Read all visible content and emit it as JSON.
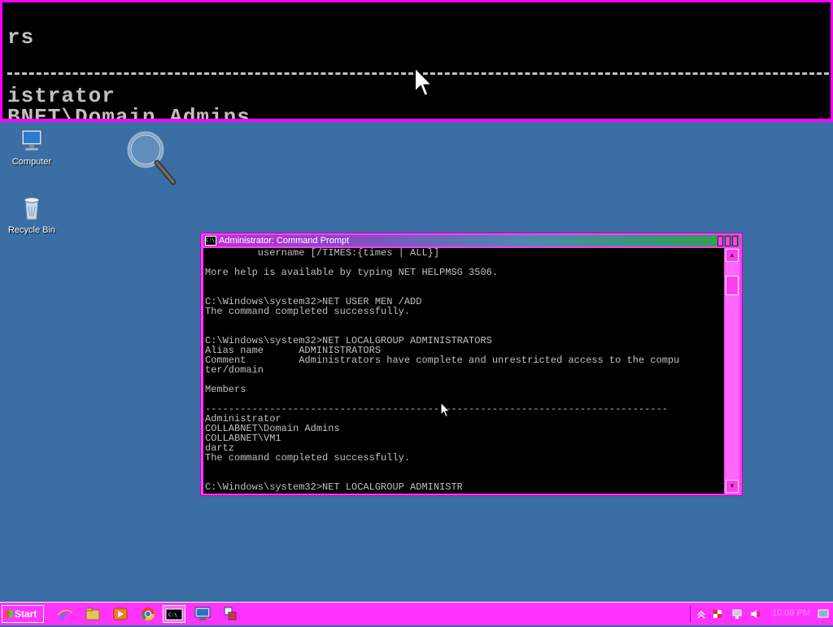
{
  "magnifier": {
    "lines": [
      "rs",
      "istrator",
      "BNET\\Domain Admins"
    ]
  },
  "desktop": {
    "icons": [
      {
        "label": "Computer",
        "icon": "computer-icon"
      },
      {
        "label": "Recycle Bin",
        "icon": "recycle-bin-icon"
      }
    ],
    "magnify_icon": "magnifier-icon"
  },
  "cmd": {
    "title": "Administrator: Command Prompt",
    "icon_text": "C:\\.",
    "lines": [
      "         username [/TIMES:{times | ALL}]",
      "",
      "More help is available by typing NET HELPMSG 3506.",
      "",
      "",
      "C:\\Windows\\system32>NET USER MEN /ADD",
      "The command completed successfully.",
      "",
      "",
      "C:\\Windows\\system32>NET LOCALGROUP ADMINISTRATORS",
      "Alias name      ADMINISTRATORS",
      "Comment         Administrators have complete and unrestricted access to the compu",
      "ter/domain",
      "",
      "Members",
      "",
      "-------------------------------------------------------------------------------",
      "Administrator",
      "COLLABNET\\Domain Admins",
      "COLLABNET\\VM1",
      "dartz",
      "The command completed successfully.",
      "",
      "",
      "C:\\Windows\\system32>NET LOCALGROUP ADMINISTR"
    ]
  },
  "taskbar": {
    "start_label": "Start",
    "items": [
      {
        "name": "internet-explorer-icon"
      },
      {
        "name": "file-explorer-icon"
      },
      {
        "name": "media-player-icon"
      },
      {
        "name": "chrome-icon"
      },
      {
        "name": "command-prompt-icon",
        "active": true
      },
      {
        "name": "remote-desktop-icon"
      },
      {
        "name": "network-app-icon"
      }
    ],
    "clock": "10:09 PM"
  },
  "colors": {
    "desktop": "#3a6ea5",
    "accent_magenta": "#ff33ff",
    "console_bg": "#000000",
    "console_fg": "#c0c0c0"
  }
}
